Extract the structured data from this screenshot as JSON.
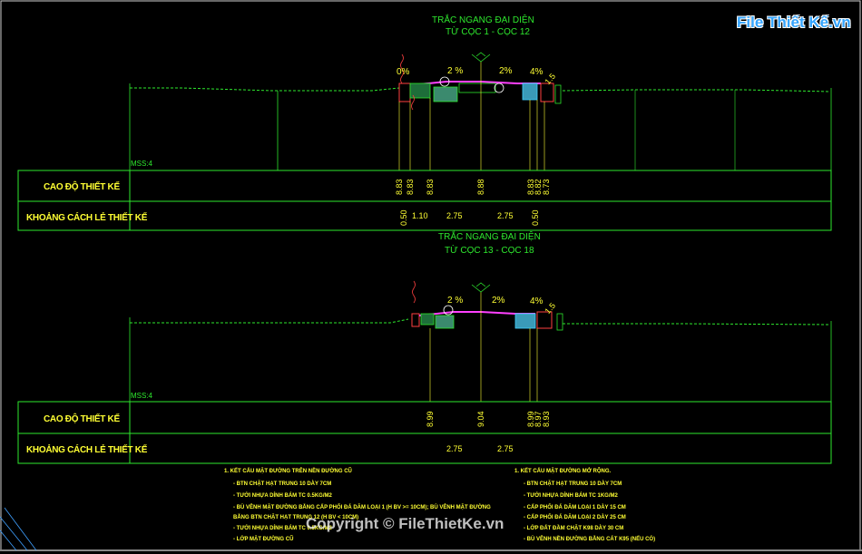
{
  "watermark": {
    "logo_text": "File Thiết Kế.vn",
    "copyright": "Copyright © FileThietKe.vn"
  },
  "section1": {
    "title": "TRẮC NGANG ĐẠI DIỆN",
    "subtitle": "TỪ CỌC 1 - CỌC 12",
    "slopes": [
      "0%",
      "2 %",
      "2%",
      "4%",
      "1.5"
    ],
    "datum": "MSS:4",
    "row_labels": [
      "CAO ĐỘ THIẾT KẾ",
      "KHOẢNG CÁCH LẺ THIẾT KẾ"
    ],
    "elevations": [
      "8.83",
      "8.83",
      "8.83",
      "8.88",
      "8.83",
      "8.82",
      "8.73"
    ],
    "distances": [
      "0.50",
      "1.10",
      "2.75",
      "2.75",
      "0.50"
    ]
  },
  "section2": {
    "title": "TRẮC NGANG ĐẠI DIỆN",
    "subtitle": "TỪ CỌC 13 - CỌC 18",
    "slopes": [
      "2 %",
      "2%",
      "4%",
      "1.5"
    ],
    "datum": "MSS:4",
    "row_labels": [
      "CAO ĐỘ THIẾT KẾ",
      "KHOẢNG CÁCH LẺ THIẾT KẾ"
    ],
    "elevations": [
      "8.99",
      "9.04",
      "8.99",
      "8.97",
      "8.93"
    ],
    "distances": [
      "2.75",
      "2.75"
    ]
  },
  "notes_left": {
    "heading": "1. KẾT CẤU MẶT ĐƯỜNG TRÊN NỀN ĐƯỜNG CŨ",
    "lines": [
      "- BTN CHẶT HẠT TRUNG 10 DÀY 7CM",
      "- TƯỚI NHỰA DÍNH BÁM TC 0.5KG/M2",
      "- BÙ VÊNH MẶT ĐƯỜNG BẰNG CẤP PHỐI ĐÁ DĂM LOẠI 1 (H BV >= 10CM); BÙ VÊNH MẶT ĐƯỜNG",
      "BẰNG BTN CHẶT HẠT TRUNG 12 (H BV < 10CM)",
      "- TƯỚI NHỰA DÍNH BÁM TC 0.5KG/M2",
      "- LỚP MẶT ĐƯỜNG CŨ"
    ]
  },
  "notes_right": {
    "heading": "1. KẾT CẤU MẶT ĐƯỜNG MỞ RỘNG.",
    "lines": [
      "- BTN CHẶT HẠT TRUNG 10 DÀY 7CM",
      "- TƯỚI NHỰA DÍNH BÁM TC 1KG/M2",
      "- CẤP PHỐI ĐÁ DĂM LOẠI 1 DÀY 15 CM",
      "- CẤP PHỐI ĐÁ DĂM LOẠI 2 DÀY 25 CM",
      "- LỚP ĐẤT ĐẦM CHẶT K98 DÀY 30 CM",
      "- BÙ VÊNH NỀN ĐƯỜNG BẰNG CÁT K95 (NẾU CÓ)"
    ]
  },
  "colors": {
    "background": "#000000",
    "table_border": "#2ee82e",
    "text": "#ffff33",
    "annotation": "#ff5a5a",
    "pavement": "#ff40ff",
    "water": "#40d0ff"
  }
}
